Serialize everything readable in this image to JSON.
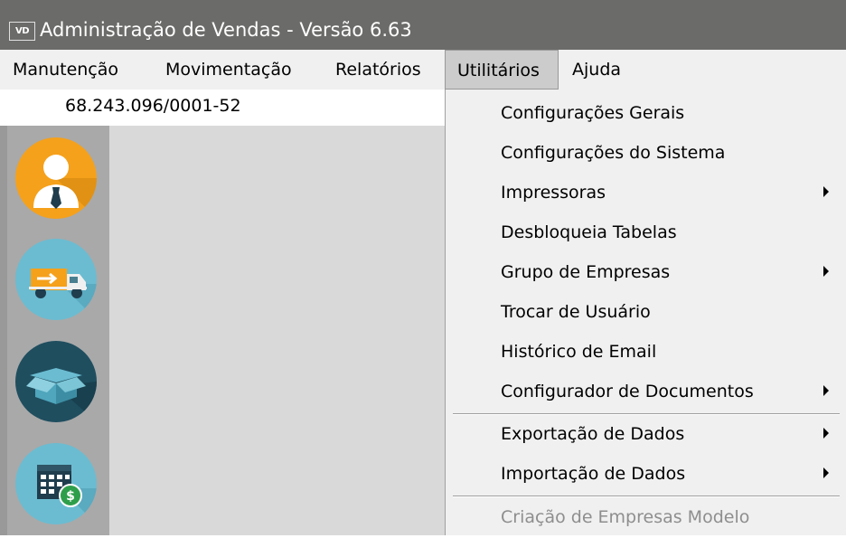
{
  "window": {
    "icon_label": "VD",
    "title": "Administração de Vendas - Versão 6.63"
  },
  "menubar": {
    "items": [
      {
        "label": "Manutenção"
      },
      {
        "label": "Movimentação"
      },
      {
        "label": "Relatórios"
      },
      {
        "label": "Utilitários",
        "active": true
      },
      {
        "label": "Ajuda"
      }
    ]
  },
  "company": {
    "cnpj": "68.243.096/0001-52"
  },
  "sidebar": {
    "icons": [
      {
        "name": "user-icon",
        "color": "#f5a11b"
      },
      {
        "name": "delivery-truck-icon",
        "color": "#6bbcd1"
      },
      {
        "name": "open-box-icon",
        "color": "#1f4e5f"
      },
      {
        "name": "calendar-money-icon",
        "color": "#6bbcd1"
      }
    ]
  },
  "utilitarios_menu": {
    "items": [
      {
        "label": "Configurações Gerais",
        "submenu": false,
        "enabled": true
      },
      {
        "label": "Configurações do Sistema",
        "submenu": false,
        "enabled": true
      },
      {
        "label": "Impressoras",
        "submenu": true,
        "enabled": true
      },
      {
        "label": "Desbloqueia Tabelas",
        "submenu": false,
        "enabled": true
      },
      {
        "label": "Grupo de Empresas",
        "submenu": true,
        "enabled": true
      },
      {
        "label": "Trocar de Usuário",
        "submenu": false,
        "enabled": true
      },
      {
        "label": "Histórico de Email",
        "submenu": false,
        "enabled": true
      },
      {
        "label": "Configurador de Documentos",
        "submenu": true,
        "enabled": true
      },
      {
        "label": "Exportação de Dados",
        "submenu": true,
        "enabled": true
      },
      {
        "label": "Importação de Dados",
        "submenu": true,
        "enabled": true
      },
      {
        "label": "Criação de Empresas Modelo",
        "submenu": false,
        "enabled": false
      }
    ]
  }
}
